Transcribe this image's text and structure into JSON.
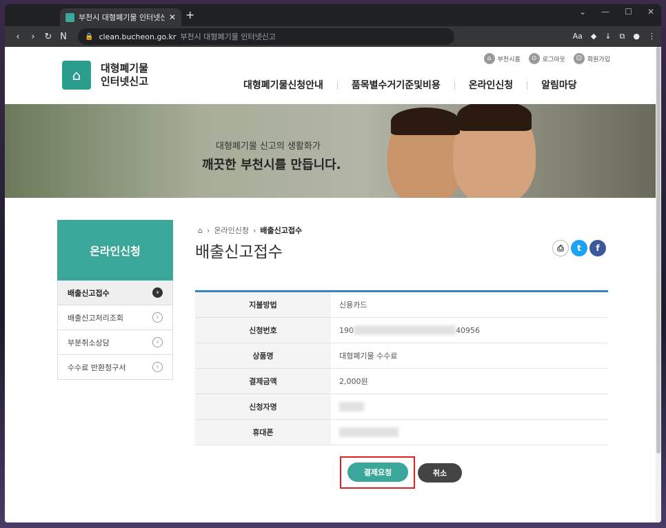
{
  "browser": {
    "tab_title": "부천시 대형폐기물 인터넷신고",
    "url_host": "clean.bucheon.go.kr",
    "url_title": "부천시 대형폐기물 인터넷신고"
  },
  "header": {
    "util_links": [
      "부천시홈",
      "로그아웃",
      "회원가입"
    ],
    "logo_line1": "대형폐기물",
    "logo_line2": "인터넷신고",
    "gnb": [
      "대형폐기물신청안내",
      "품목별수거기준및비용",
      "온라인신청",
      "알림마당"
    ]
  },
  "hero": {
    "line1": "대형폐기물 신고의 생활화가",
    "line2": "깨끗한 부천시를 만듭니다."
  },
  "sidebar": {
    "title": "온라인신청",
    "items": [
      {
        "label": "배출신고접수",
        "active": true
      },
      {
        "label": "배출신고처리조회"
      },
      {
        "label": "부분취소상담"
      },
      {
        "label": "수수료 반환청구서"
      }
    ]
  },
  "breadcrumb": {
    "parent": "온라인신청",
    "current": "배출신고접수"
  },
  "page_title": "배출신고접수",
  "table": [
    {
      "label": "지불방법",
      "value": "신용카드"
    },
    {
      "label": "신청번호",
      "value_prefix": "190",
      "value_suffix": "40956"
    },
    {
      "label": "상품명",
      "value": "대형폐기물 수수료"
    },
    {
      "label": "결제금액",
      "value": "2,000원"
    },
    {
      "label": "신청자명",
      "value": ""
    },
    {
      "label": "휴대폰",
      "value": ""
    }
  ],
  "buttons": {
    "pay": "결제요청",
    "cancel": "취소"
  },
  "colors": {
    "accent": "#3aa79a",
    "table_top": "#3b82c4",
    "highlight": "#e02020"
  }
}
